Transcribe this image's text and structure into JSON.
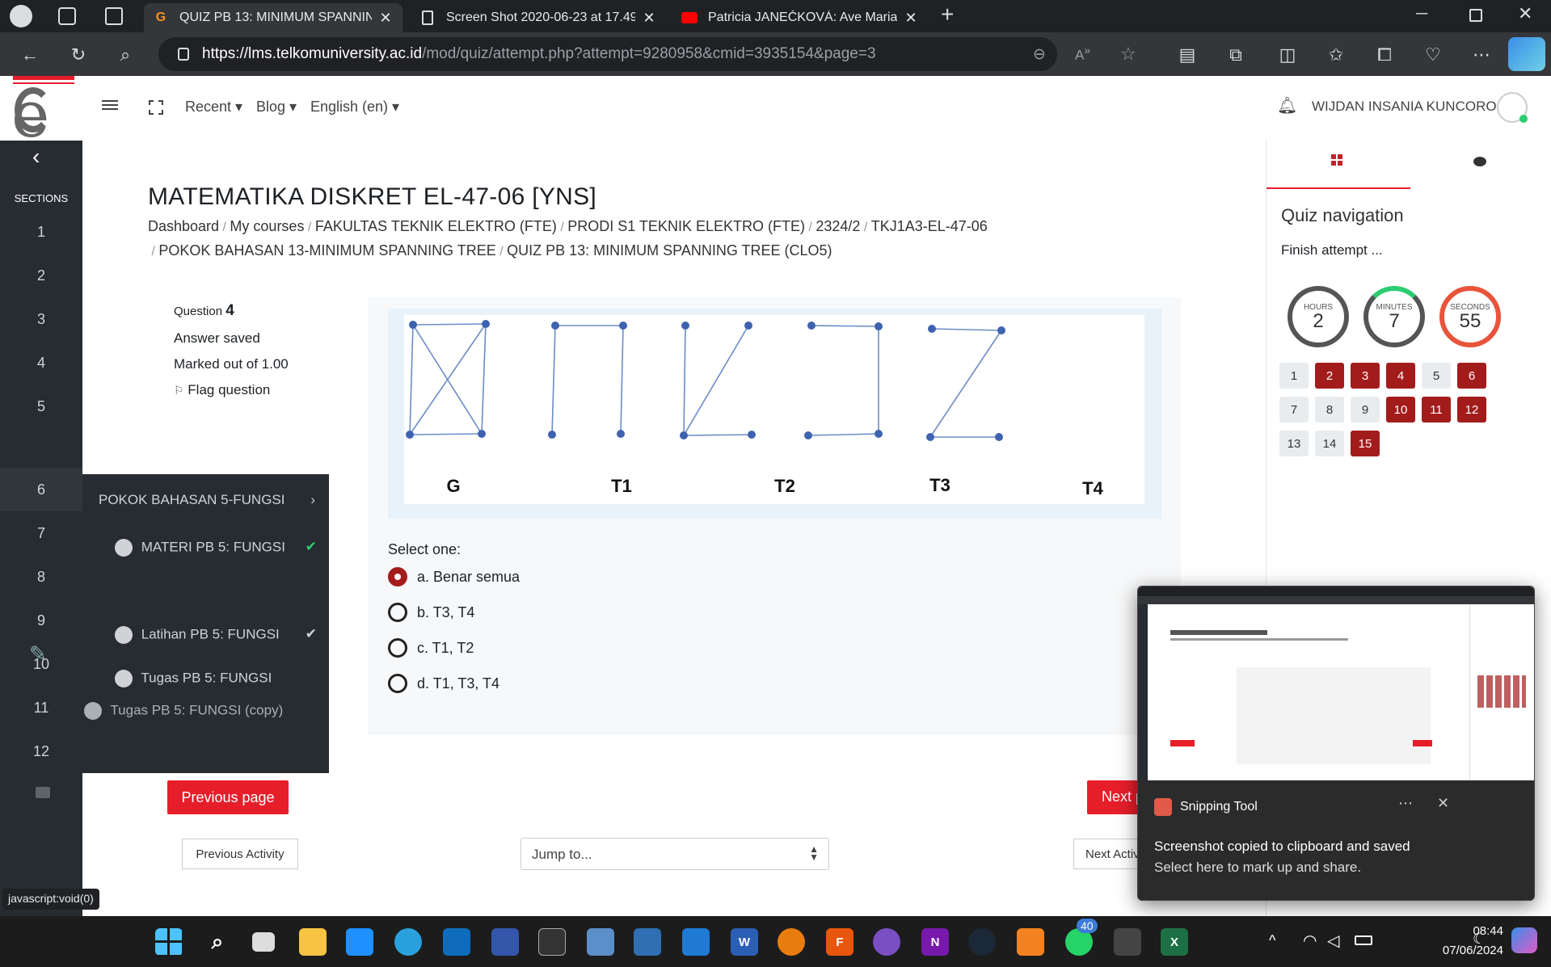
{
  "browser": {
    "tabs": [
      {
        "title": "QUIZ PB 13: MINIMUM SPANNIN",
        "active": true
      },
      {
        "title": "Screen Shot 2020-06-23 at 17.49",
        "active": false
      },
      {
        "title": "Patricia JANEČKOVÁ: Ave Maria (",
        "active": false
      }
    ],
    "url_domain": "https://lms.telkomuniversity.ac.id",
    "url_path": "/mod/quiz/attempt.php?attempt=9280958&cmid=3935154&page=3",
    "status_bar": "javascript:void(0)"
  },
  "navbar": {
    "menu": [
      "Recent",
      "Blog",
      "English (en)"
    ],
    "user": "WIJDAN INSANIA KUNCORO"
  },
  "sidebar": {
    "sections_label": "SECTIONS",
    "numbers": [
      "1",
      "2",
      "3",
      "4",
      "5",
      "6",
      "7",
      "8",
      "9",
      "10",
      "11",
      "12"
    ]
  },
  "drawer": {
    "title": "POKOK BAHASAN 5-FUNGSI",
    "items": [
      {
        "label": "MATERI PB 5: FUNGSI",
        "done": true
      },
      {
        "label": "Latihan PB 5: FUNGSI",
        "done": true
      },
      {
        "label": "Tugas PB 5: FUNGSI",
        "done": false
      },
      {
        "label": "Tugas PB 5: FUNGSI (copy)",
        "done": false
      }
    ]
  },
  "course": {
    "title": "MATEMATIKA DISKRET EL-47-06 [YNS]",
    "breadcrumb": [
      "Dashboard",
      "My courses",
      "FAKULTAS TEKNIK ELEKTRO (FTE)",
      "PRODI S1 TEKNIK ELEKTRO (FTE)",
      "2324/2",
      "TKJ1A3-EL-47-06",
      "POKOK BAHASAN 13-MINIMUM SPANNING TREE",
      "QUIZ PB 13: MINIMUM SPANNING TREE (CLO5)"
    ]
  },
  "question": {
    "label": "Question",
    "number": "4",
    "state": "Answer saved",
    "marks": "Marked out of 1.00",
    "flag": "Flag question",
    "graph_labels": [
      "G",
      "T1",
      "T2",
      "T3",
      "T4"
    ],
    "prompt": "Select one:",
    "options": [
      {
        "text": "a. Benar semua",
        "selected": true
      },
      {
        "text": "b. T3, T4",
        "selected": false
      },
      {
        "text": "c. T1, T2",
        "selected": false
      },
      {
        "text": "d. T1, T3, T4",
        "selected": false
      }
    ]
  },
  "nav_buttons": {
    "previous_page": "Previous page",
    "next_page": "Next p",
    "previous_activity": "Previous Activity",
    "jump_to": "Jump to...",
    "next_activity": "Next Activ"
  },
  "quiz_nav": {
    "title": "Quiz navigation",
    "finish": "Finish attempt ...",
    "timer": [
      {
        "label": "HOURS",
        "value": "2",
        "color": "#555555"
      },
      {
        "label": "MINUTES",
        "value": "7",
        "color": "#555555"
      },
      {
        "label": "SECONDS",
        "value": "55",
        "color": "#e8543a"
      }
    ],
    "questions": [
      {
        "n": "1",
        "answered": false
      },
      {
        "n": "2",
        "answered": true
      },
      {
        "n": "3",
        "answered": true
      },
      {
        "n": "4",
        "answered": true
      },
      {
        "n": "5",
        "answered": false
      },
      {
        "n": "6",
        "answered": true
      },
      {
        "n": "7",
        "answered": false
      },
      {
        "n": "8",
        "answered": false
      },
      {
        "n": "9",
        "answered": false
      },
      {
        "n": "10",
        "answered": true
      },
      {
        "n": "11",
        "answered": true
      },
      {
        "n": "12",
        "answered": true
      },
      {
        "n": "13",
        "answered": false
      },
      {
        "n": "14",
        "answered": false
      },
      {
        "n": "15",
        "answered": true
      }
    ]
  },
  "toast": {
    "app": "Snipping Tool",
    "line1": "Screenshot copied to clipboard and saved",
    "line2": "Select here to mark up and share."
  },
  "taskbar": {
    "time": "08:44",
    "date": "07/06/2024",
    "whatsapp_badge": "40"
  },
  "colors": {
    "accent": "#e61e2a",
    "answered": "#a31c1c",
    "sidebar": "#262c31"
  }
}
